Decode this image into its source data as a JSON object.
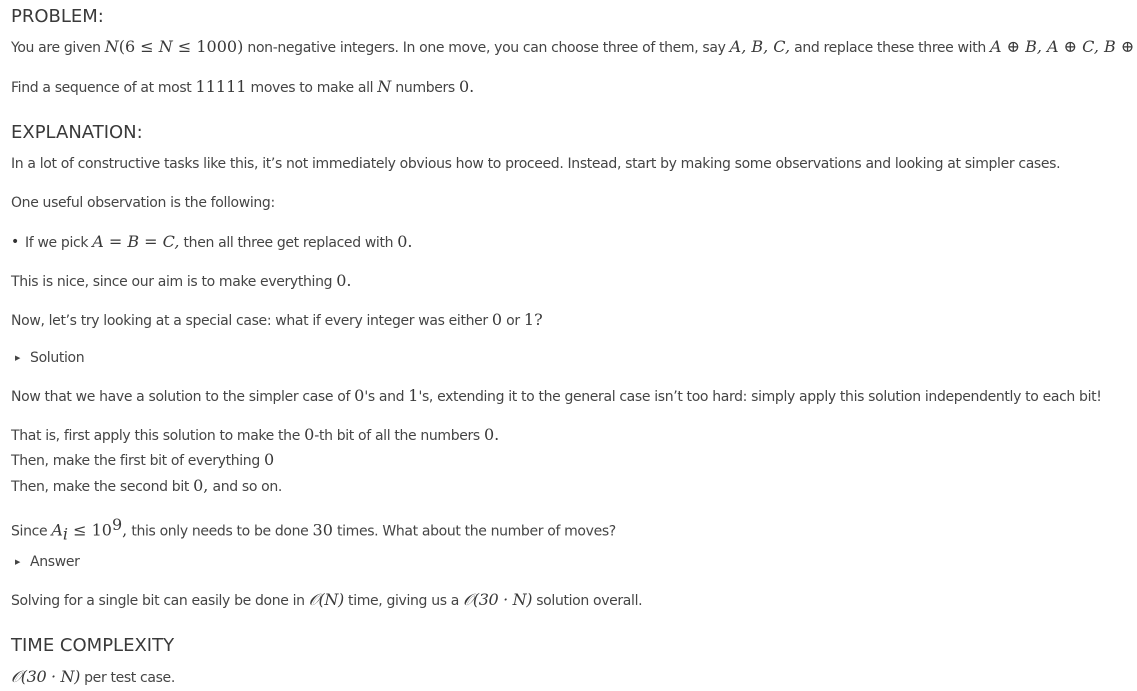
{
  "sections": {
    "problem_heading": "PROBLEM:",
    "explanation_heading": "EXPLANATION:",
    "time_heading": "TIME COMPLEXITY"
  },
  "problem": {
    "l1a": "You are given ",
    "l1b": "N",
    "l1c": "(6 ≤ ",
    "l1d": "N",
    "l1e": " ≤ 1000)",
    "l1f": " non-negative integers. In one move, you can choose three of them, say ",
    "l1g": "A, B, C,",
    "l1h": " and replace these three with ",
    "l1i": "A ⊕ B, A ⊕ C, B ⊕ C.",
    "l2a": "Find a sequence of at most ",
    "l2b": "11111",
    "l2c": " moves to make all ",
    "l2d": "N",
    "l2e": " numbers ",
    "l2f": "0."
  },
  "explanation": {
    "p1": "In a lot of constructive tasks like this, it’s not immediately obvious how to proceed. Instead, start by making some observations and looking at simpler cases.",
    "p2": "One useful observation is the following:",
    "b1a": "If we pick ",
    "b1b": "A = B = C,",
    "b1c": " then all three get replaced with ",
    "b1d": "0.",
    "p3a": "This is nice, since our aim is to make everything ",
    "p3b": "0.",
    "p4a": "Now, let’s try looking at a special case: what if every integer was either ",
    "p4b": "0",
    "p4c": " or ",
    "p4d": "1?",
    "solution_label": "Solution",
    "p5a": "Now that we have a solution to the simpler case of ",
    "p5b": "0",
    "p5c": "'s and ",
    "p5d": "1",
    "p5e": "'s, extending it to the general case isn’t too hard: simply apply this solution independently to each bit!",
    "p6a": "That is, first apply this solution to make the ",
    "p6b": "0",
    "p6c": "-th bit of all the numbers ",
    "p6d": "0.",
    "p7a": "Then, make the first bit of everything ",
    "p7b": "0",
    "p8a": "Then, make the second bit ",
    "p8b": "0,",
    "p8c": " and so on.",
    "p9a": "Since ",
    "p9b": "A",
    "p9c": "i",
    "p9d": " ≤ 10",
    "p9e": "9",
    "p9f": ",",
    "p9g": " this only needs to be done ",
    "p9h": "30",
    "p9i": " times. What about the number of moves?",
    "answer_label": "Answer",
    "p10a": "Solving for a single bit can easily be done in ",
    "p10b": "𝒪(N)",
    "p10c": " time, giving us a ",
    "p10d": "𝒪(30 · N)",
    "p10e": " solution overall."
  },
  "time": {
    "a": "𝒪(30 · N)",
    "b": " per test case."
  }
}
